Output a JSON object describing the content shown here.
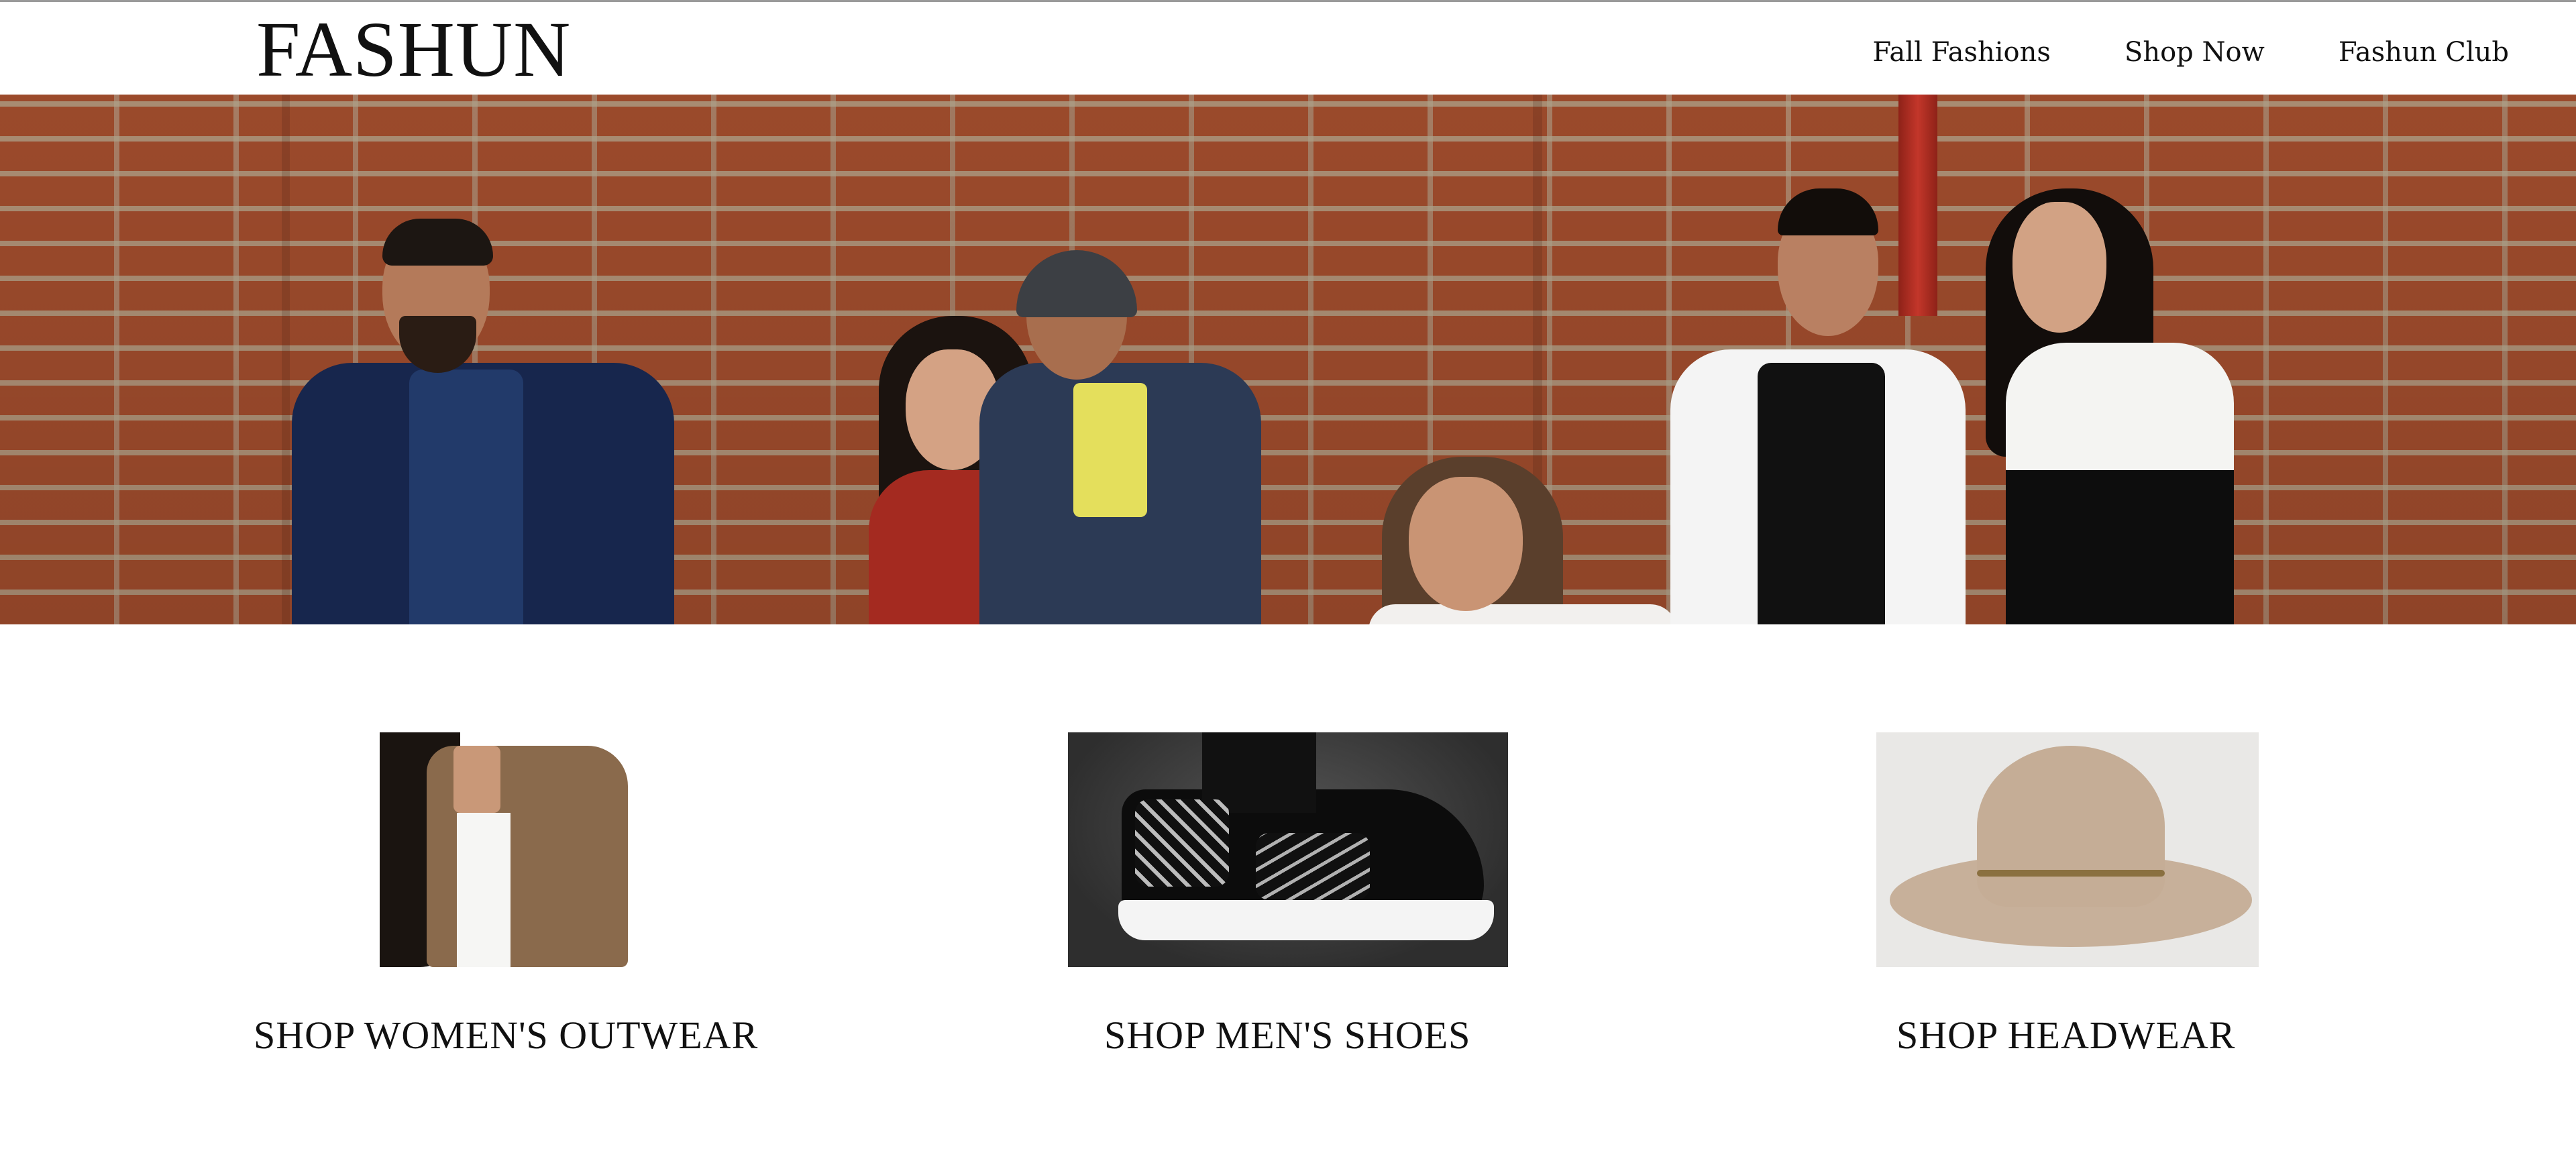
{
  "brand": {
    "logo": "FASHUN"
  },
  "nav": {
    "items": [
      {
        "label": "Fall Fashions"
      },
      {
        "label": "Shop Now"
      },
      {
        "label": "Fashun Club"
      }
    ]
  },
  "hero": {
    "image": "group-of-models-on-brick-wall"
  },
  "products": [
    {
      "image": "womens-brown-jacket-photo",
      "title": "SHOP WOMEN'S OUTWEAR"
    },
    {
      "image": "mens-black-white-sneaker-photo",
      "title": "SHOP MEN'S SHOES"
    },
    {
      "image": "beige-fedora-hat-photo",
      "title": "SHOP HEADWEAR"
    }
  ],
  "colors": {
    "text": "#111111",
    "background": "#ffffff",
    "brick": "#a8502f"
  }
}
